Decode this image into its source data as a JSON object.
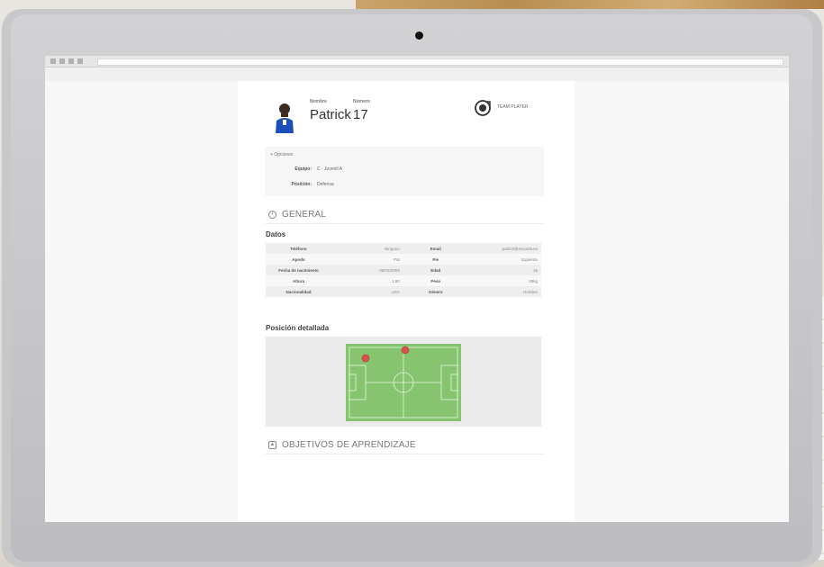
{
  "player": {
    "nombre_label": "Nombre",
    "numero_label": "Número",
    "name": "Patrick",
    "number": "17",
    "team_player_label": "TEAM PLAYER"
  },
  "equipos": {
    "title": "+ Opciones",
    "rows": [
      {
        "key": "Equipo:",
        "value": "C - Juvenil A"
      },
      {
        "key": "Posición:",
        "value": "Defensa"
      }
    ]
  },
  "general": {
    "title": "GENERAL",
    "icon": "info-circle-icon"
  },
  "datos": {
    "title": "Datos",
    "rows": [
      {
        "k1": "Teléfono",
        "v1": "Ninguno",
        "k2": "Email",
        "v2": "patrick@escuela.es"
      },
      {
        "k1": "Apodo",
        "v1": "Pat",
        "k2": "Pie",
        "v2": "Izquierdo"
      },
      {
        "k1": "Fecha de nacimiento",
        "v1": "06/03/2003",
        "k2": "Edad",
        "v2": "16"
      },
      {
        "k1": "Altura",
        "v1": "1.80",
        "k2": "Peso",
        "v2": "68kg"
      },
      {
        "k1": "Nacionalidad",
        "v1": "USA",
        "k2": "Género",
        "v2": "Hombre"
      }
    ]
  },
  "posicion": {
    "title": "Posición detallada",
    "pitch_color": "#86c470",
    "marker_color": "#d9534f"
  },
  "objetivos": {
    "title": "OBJETIVOS DE APRENDIZAJE",
    "icon": "graduation-cap-icon"
  }
}
